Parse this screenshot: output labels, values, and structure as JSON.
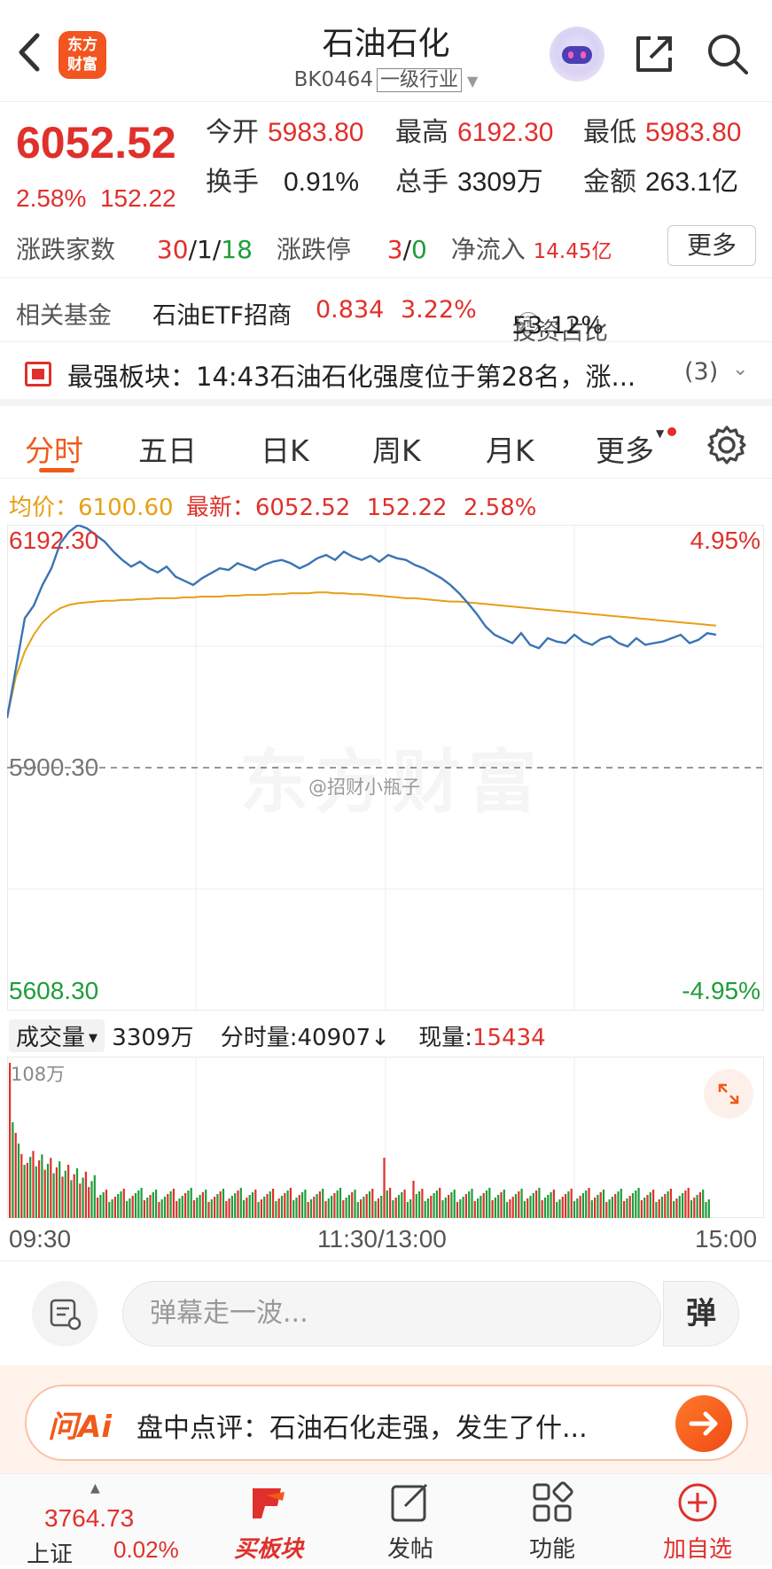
{
  "header": {
    "title": "石油石化",
    "code": "BK0464",
    "industry_tag": "一级行业",
    "logo_text_1": "东方",
    "logo_text_2": "财富"
  },
  "quote": {
    "price": "6052.52",
    "change_pct": "2.58%",
    "change_abs": "152.22",
    "open_label": "今开",
    "open": "5983.80",
    "high_label": "最高",
    "high": "6192.30",
    "low_label": "最低",
    "low": "5983.80",
    "turnover_label": "换手",
    "turnover": "0.91%",
    "volume_label": "总手",
    "volume": "3309万",
    "amount_label": "金额",
    "amount": "263.1亿",
    "updown_label": "涨跌家数",
    "up": "30",
    "flat": "1",
    "down": "18",
    "limit_label": "涨跌停",
    "limit_up": "3",
    "limit_down": "0",
    "netflow_label": "净流入",
    "netflow": "14.45亿",
    "more_label": "更多"
  },
  "fund": {
    "label": "相关基金",
    "name": "石油ETF招商",
    "price": "0.834",
    "pct": "3.22%",
    "ratio_label": "投资占比",
    "ratio": "53.12%"
  },
  "board": {
    "text": "最强板块：14:43石油石化强度位于第28名，涨...",
    "count": "(3)"
  },
  "tabs": [
    "分时",
    "五日",
    "日K",
    "周K",
    "月K",
    "更多"
  ],
  "info": {
    "avg_label": "均价：",
    "avg": "6100.60",
    "latest_label": "最新：",
    "latest": "6052.52",
    "chg": "152.22",
    "pct": "2.58%"
  },
  "chart_labels": {
    "top_price": "6192.30",
    "mid_price": "5900.30",
    "bottom_price": "5608.30",
    "top_pct": "4.95%",
    "bottom_pct": "-4.95%",
    "watermark": "东方财富",
    "weibo": "@招财小瓶子"
  },
  "volume_header": {
    "selector": "成交量",
    "total": "3309万",
    "minute_label": "分时量:",
    "minute": "40907↓",
    "current_label": "现量:",
    "current": "15434",
    "max": "108万"
  },
  "time_axis": [
    "09:30",
    "11:30/13:00",
    "15:00"
  ],
  "danmaku": {
    "placeholder": "弹幕走一波...",
    "button": "弹"
  },
  "ai": {
    "brand": "问Ai",
    "text": "盘中点评：石油石化走强，发生了什..."
  },
  "bottom": {
    "index_value": "3764.73",
    "index_name": "上证",
    "index_pct": "0.02%",
    "items": [
      "买板块",
      "发帖",
      "功能",
      "加自选"
    ]
  },
  "colors": {
    "up": "#e0302b",
    "down": "#1f9d3a",
    "accent": "#f05a1a",
    "avg_line": "#e6a014",
    "price_line": "#3a74b5"
  },
  "chart_data": {
    "type": "line",
    "ylim": [
      5608.3,
      6192.3
    ],
    "x": [
      "09:30",
      "11:30/13:00",
      "15:00"
    ],
    "series": [
      {
        "name": "最新",
        "values": [
          5960,
          6020,
          6080,
          6095,
          6120,
          6140,
          6170,
          6184,
          6192,
          6188,
          6180,
          6172,
          6160,
          6150,
          6142,
          6148,
          6140,
          6135,
          6142,
          6130,
          6125,
          6120,
          6128,
          6134,
          6140,
          6138,
          6146,
          6142,
          6138,
          6144,
          6148,
          6150,
          6146,
          6140,
          6145,
          6152,
          6156,
          6150,
          6160,
          6154,
          6150,
          6155,
          6148,
          6156,
          6152,
          6150,
          6144,
          6140,
          6134,
          6128,
          6120,
          6110,
          6098,
          6085,
          6070,
          6060,
          6055,
          6050,
          6062,
          6048,
          6044,
          6056,
          6052,
          6050,
          6060,
          6052,
          6048,
          6055,
          6058,
          6050,
          6046,
          6056,
          6048,
          6050,
          6052,
          6056,
          6060,
          6050,
          6054,
          6062,
          6060
        ]
      },
      {
        "name": "均价",
        "values": [
          5960,
          6010,
          6040,
          6060,
          6075,
          6085,
          6092,
          6096,
          6098,
          6099,
          6100,
          6101,
          6101,
          6102,
          6102,
          6103,
          6103,
          6104,
          6104,
          6104,
          6105,
          6105,
          6106,
          6106,
          6106,
          6107,
          6107,
          6108,
          6108,
          6108,
          6109,
          6109,
          6110,
          6110,
          6110,
          6111,
          6111,
          6110,
          6110,
          6109,
          6109,
          6108,
          6107,
          6106,
          6105,
          6104,
          6104,
          6103,
          6102,
          6101,
          6100,
          6100,
          6099,
          6098,
          6097,
          6096,
          6095,
          6094,
          6093,
          6092,
          6091,
          6090,
          6089,
          6088,
          6087,
          6086,
          6085,
          6084,
          6083,
          6082,
          6081,
          6080,
          6079,
          6078,
          6077,
          6076,
          6075,
          6074,
          6073,
          6072,
          6071
        ]
      }
    ],
    "volume_max": 108,
    "volume_unit": "万"
  }
}
